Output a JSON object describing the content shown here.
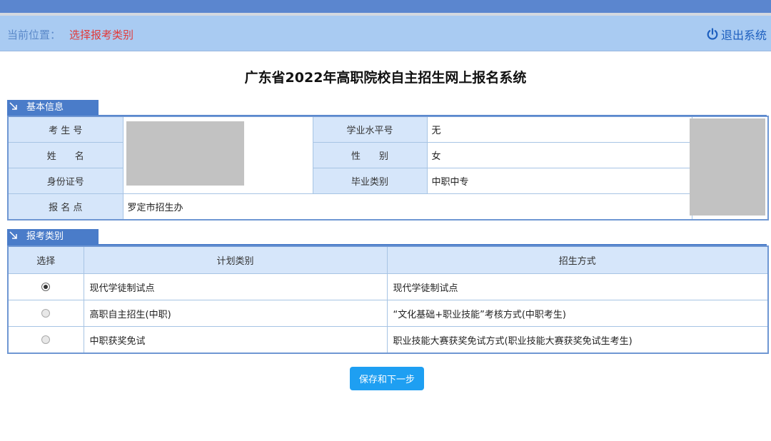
{
  "header": {
    "location_label": "当前位置：",
    "location_value": "选择报考类别",
    "logout_label": "退出系统"
  },
  "page_title": "广东省2022年高职院校自主招生网上报名系统",
  "basic_info": {
    "section_title": "基本信息",
    "labels": {
      "exam_no": "考 生 号",
      "name": "姓　　名",
      "id_no": "身份证号",
      "reg_point": "报 名 点",
      "academic_no": "学业水平号",
      "gender": "性　　别",
      "grad_type": "毕业类别"
    },
    "values": {
      "academic_no": "无",
      "gender": "女",
      "grad_type": "中职中专",
      "reg_point": "罗定市招生办"
    }
  },
  "apply": {
    "section_title": "报考类别",
    "headers": {
      "select": "选择",
      "plan": "计划类别",
      "method": "招生方式"
    },
    "rows": [
      {
        "plan": "现代学徒制试点",
        "method": "现代学徒制试点",
        "checked": true
      },
      {
        "plan": "高职自主招生(中职)",
        "method": "“文化基础+职业技能”考核方式(中职考生)",
        "checked": false
      },
      {
        "plan": "中职获奖免试",
        "method": "职业技能大赛获奖免试方式(职业技能大赛获奖免试生考生)",
        "checked": false
      }
    ]
  },
  "actions": {
    "save_next": "保存和下一步"
  },
  "icons": {
    "logout": "power-icon",
    "section": "corner-arrow-icon"
  },
  "colors": {
    "accent": "#4a7cc9",
    "button": "#1e9ff2",
    "location_value": "#e23a3a"
  }
}
